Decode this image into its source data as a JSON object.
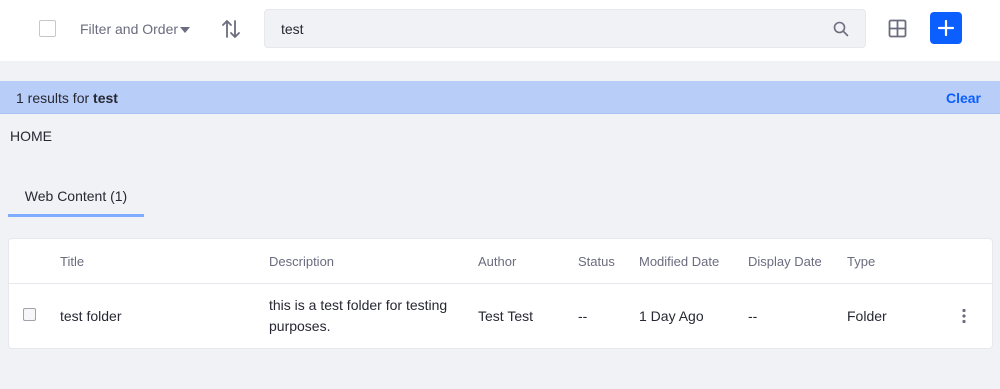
{
  "toolbar": {
    "filter_label": "Filter and Order",
    "search_value": "test",
    "icons": {
      "sort": "sort-arrows-icon",
      "search": "search-icon",
      "view": "grid-icon",
      "add": "plus-icon",
      "caret": "caret-down-icon"
    },
    "accent_color": "#0b5fff"
  },
  "results": {
    "count_text": "1 results for",
    "query": "test",
    "clear_label": "Clear",
    "bar_color": "#b8cdf8"
  },
  "breadcrumb": "HOME",
  "tab": {
    "label": "Web Content (1)"
  },
  "table": {
    "columns": [
      "Title",
      "Description",
      "Author",
      "Status",
      "Modified Date",
      "Display Date",
      "Type"
    ],
    "rows": [
      {
        "title": "test folder",
        "description": "this is a test folder for testing purposes.",
        "author": "Test Test",
        "status": "--",
        "modified_date": "1 Day Ago",
        "display_date": "--",
        "type": "Folder"
      }
    ]
  }
}
